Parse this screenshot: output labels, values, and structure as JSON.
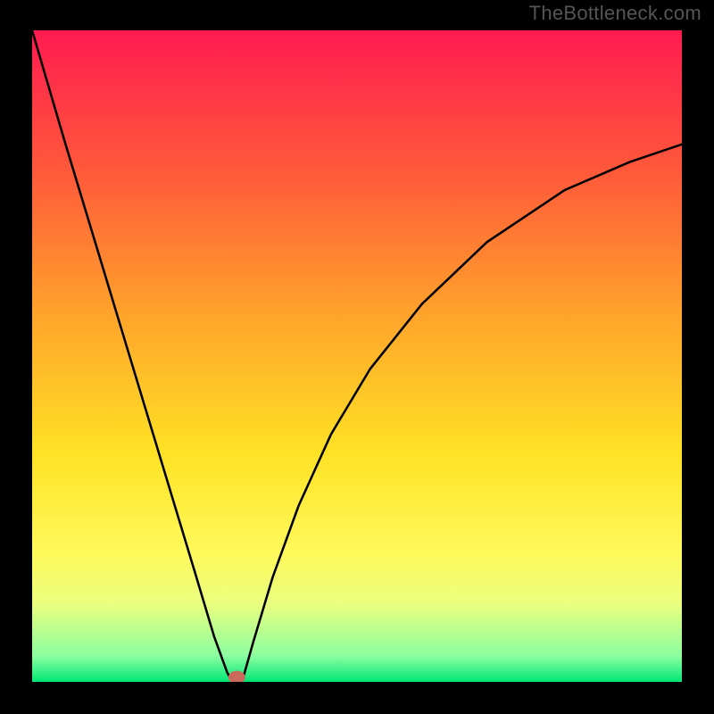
{
  "watermark": "TheBottleneck.com",
  "chart_data": {
    "type": "line",
    "title": "",
    "xlabel": "",
    "ylabel": "",
    "xlim": [
      0,
      100
    ],
    "ylim": [
      0,
      100
    ],
    "grid": false,
    "legend": false,
    "background_gradient_stops": [
      {
        "offset": 0,
        "color": "#ff1a50"
      },
      {
        "offset": 22,
        "color": "#ff5a3a"
      },
      {
        "offset": 45,
        "color": "#ffa82a"
      },
      {
        "offset": 65,
        "color": "#ffe225"
      },
      {
        "offset": 80,
        "color": "#fff95a"
      },
      {
        "offset": 88,
        "color": "#eaff7e"
      },
      {
        "offset": 96,
        "color": "#8cffa0"
      },
      {
        "offset": 100,
        "color": "#00e676"
      }
    ],
    "series": [
      {
        "name": "left-branch",
        "x": [
          0,
          5,
          10,
          15,
          20,
          25,
          28,
          30,
          30.8
        ],
        "y": [
          100,
          83,
          66.5,
          50,
          33.5,
          17,
          7,
          1.5,
          0
        ],
        "color": "#000000"
      },
      {
        "name": "minimum-flat",
        "x": [
          30.8,
          31.5,
          32.3
        ],
        "y": [
          0,
          0,
          0
        ],
        "color": "#000000"
      },
      {
        "name": "right-branch",
        "x": [
          32.3,
          34,
          37,
          41,
          46,
          52,
          60,
          70,
          82,
          92,
          100
        ],
        "y": [
          0,
          6,
          16,
          27,
          38,
          48,
          58,
          67.5,
          75.5,
          79.8,
          82.5
        ],
        "color": "#000000"
      }
    ],
    "markers": [
      {
        "name": "minimum-marker",
        "x": 31.5,
        "y": 0.7,
        "rx": 1.3,
        "ry": 1.0,
        "color": "#c96a5a"
      }
    ]
  }
}
